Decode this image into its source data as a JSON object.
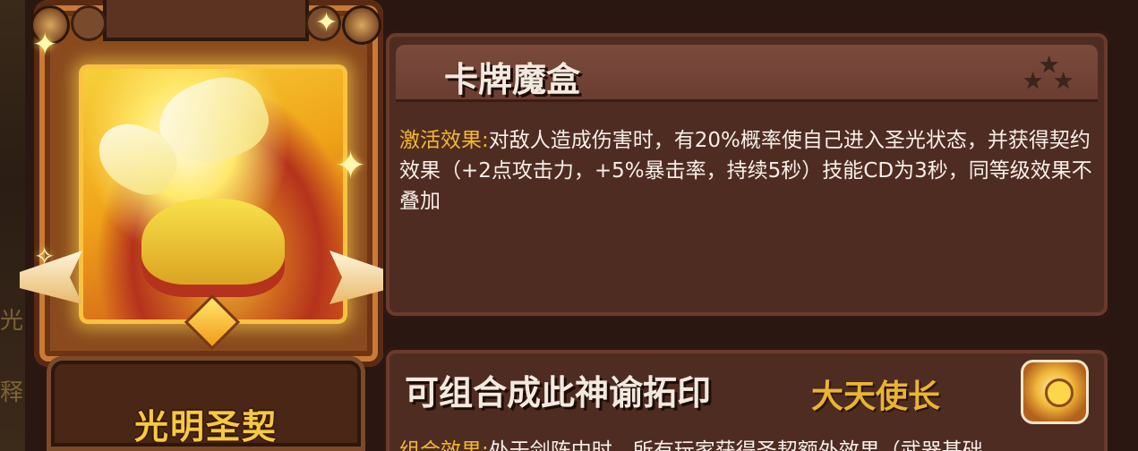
{
  "left_strip": {
    "ghost_text_1": "光",
    "ghost_text_2": "释"
  },
  "card": {
    "name": "光明圣契",
    "art_icon": "golden-winged-helmet-icon"
  },
  "panel_1": {
    "title": "卡牌魔盒",
    "rank_icon": "three-stars-icon",
    "effect_label": "激活效果:",
    "effect_text": "对敌人造成伤害时，有20%概率使自己进入圣光状态，并获得契约效果（+2点攻击力，+5%暴击率，持续5秒）技能CD为3秒，同等级效果不叠加"
  },
  "panel_2": {
    "title": "可组合成此神谕拓印",
    "subtitle": "大天使长",
    "emblem_icon": "archangel-emblem-icon",
    "effect_label": "组合效果:",
    "effect_text": "处于剑阵中时，所有玩家获得圣契额外效果（武器基础"
  },
  "colors": {
    "gold_label": "#f0b832",
    "card_name": "#f5c941",
    "panel_bg": "#4f2c22"
  }
}
